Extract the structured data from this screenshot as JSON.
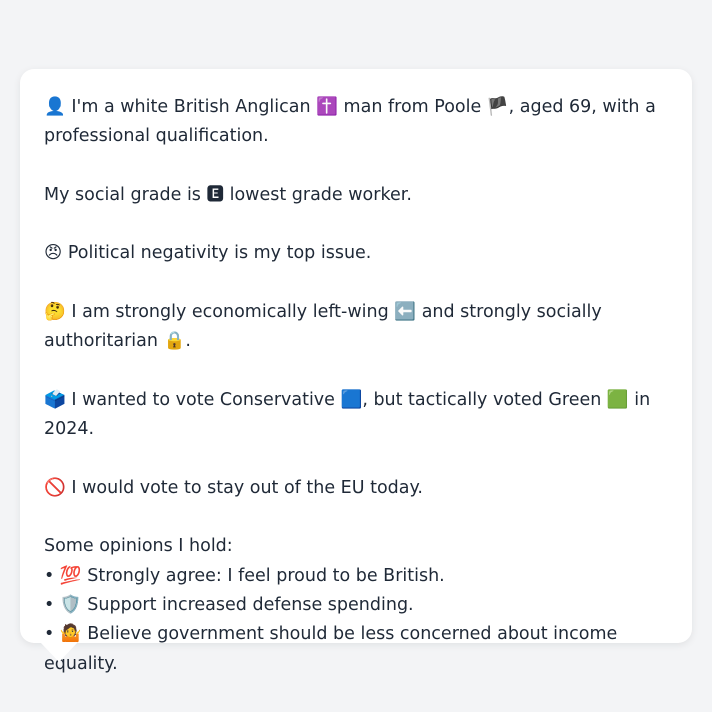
{
  "message": {
    "identity": {
      "icon": "👤",
      "prefix": "I'm a white British Anglican",
      "religion_icon": "✝️",
      "middle": "man from Poole",
      "flag_icon": "🏴",
      "suffix": ", aged 69, with a professional qualification."
    },
    "social_grade": {
      "prefix": "My social grade is",
      "grade_icon": "🅴",
      "suffix": "lowest grade worker."
    },
    "top_issue": {
      "icon": "😠",
      "text": "Political negativity is my top issue."
    },
    "ideology": {
      "icon": "🤔",
      "prefix": "I am strongly economically left-wing",
      "left_icon": "⬅️",
      "middle": "and strongly socially authoritarian",
      "lock_icon": "🔒",
      "suffix": "."
    },
    "vote": {
      "icon": "🗳️",
      "prefix": "I wanted to vote Conservative",
      "con_icon": "🟦",
      "middle": ", but tactically voted Green",
      "green_icon": "🟩",
      "suffix": "in 2024."
    },
    "eu": {
      "icon": "🚫",
      "text": "I would vote to stay out of the EU today."
    },
    "opinions": {
      "heading": "Some opinions I hold:",
      "items": [
        {
          "bullet": "•",
          "icon": "💯",
          "text": "Strongly agree: I feel proud to be British."
        },
        {
          "bullet": "•",
          "icon": "🛡️",
          "text": "Support increased defense spending."
        },
        {
          "bullet": "•",
          "icon": "🤷",
          "text": "Believe government should be less concerned about income equality."
        }
      ]
    }
  }
}
